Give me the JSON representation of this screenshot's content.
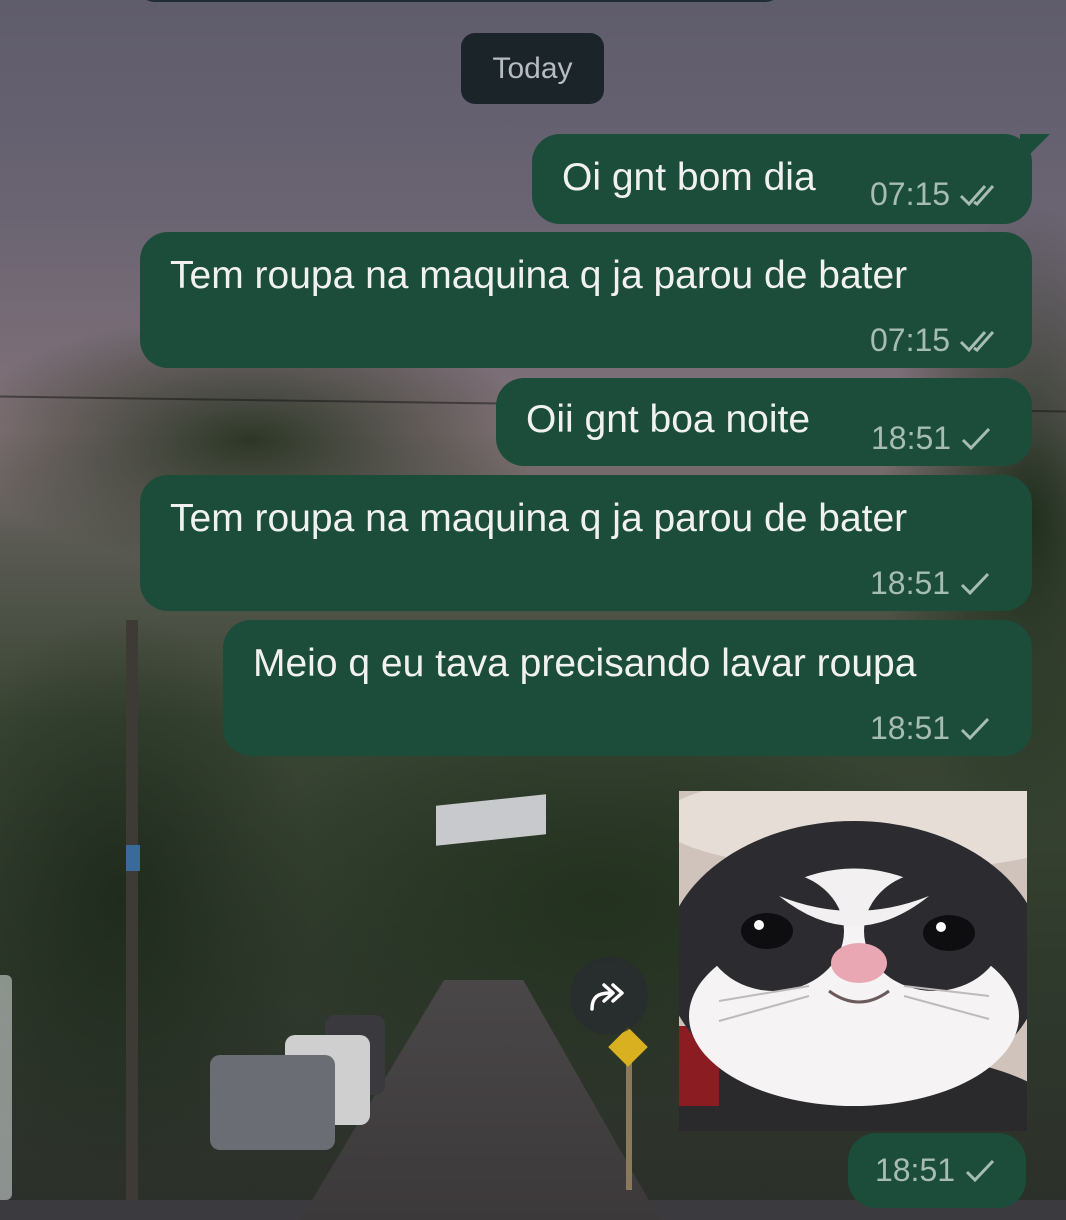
{
  "chat": {
    "date_divider": "Today",
    "messages": [
      {
        "text": "Oi gnt bom dia",
        "time": "07:15",
        "status": "read"
      },
      {
        "text": "Tem roupa na maquina q ja parou de bater",
        "time": "07:15",
        "status": "read"
      },
      {
        "text": "Oii gnt boa noite",
        "time": "18:51",
        "status": "sent"
      },
      {
        "text": "Tem roupa na maquina q ja parou de bater",
        "time": "18:51",
        "status": "sent"
      },
      {
        "text": "Meio q eu tava precisando lavar roupa",
        "time": "18:51",
        "status": "sent"
      }
    ],
    "sticker": {
      "time": "18:51",
      "status": "sent",
      "icon": "forward-icon"
    }
  },
  "colors": {
    "bubble_outgoing": "#1b4d3a",
    "date_chip": "#1b2429",
    "meta_text": "#a7bcb2"
  }
}
